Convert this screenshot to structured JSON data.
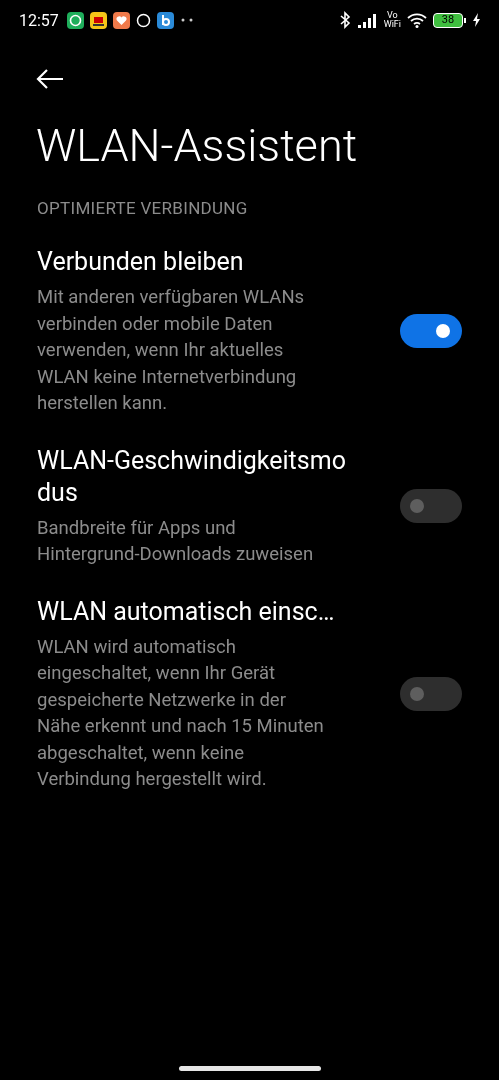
{
  "status_bar": {
    "time": "12:57",
    "volte_top": "Vo",
    "volte_bottom": "WiFi",
    "battery": "38"
  },
  "title": "WLAN-Assistent",
  "section": "OPTIMIERTE VERBINDUNG",
  "settings": [
    {
      "title": "Verbunden bleiben",
      "description": "Mit anderen verfügbaren WLANs verbinden oder mobile Daten verwenden, wenn Ihr aktuelles WLAN keine Internetverbindung herstellen kann.",
      "on": true
    },
    {
      "title": "WLAN-Geschwindigkeitsmodus",
      "description": "Bandbreite für Apps und Hintergrund-Downloads zuweisen",
      "on": false
    },
    {
      "title": "WLAN automatisch einsc…",
      "description": "WLAN wird automatisch eingeschaltet, wenn Ihr Gerät gespeicherte Netzwerke in der Nähe erkennt und nach 15 Minuten abgeschaltet, wenn keine Verbindung hergestellt wird.",
      "on": false
    }
  ]
}
